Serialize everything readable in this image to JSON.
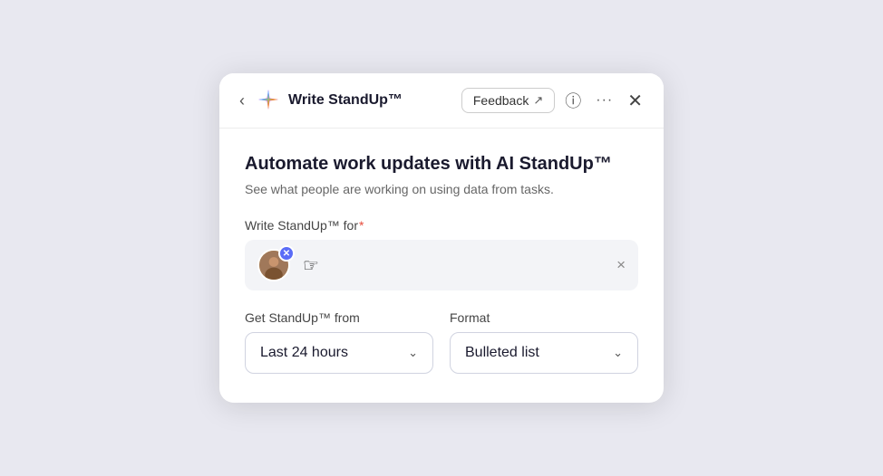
{
  "header": {
    "back_label": "‹",
    "title": "Write StandUp™",
    "feedback_label": "Feedback",
    "feedback_icon": "↗",
    "info_icon": "ⓘ",
    "more_icon": "•••",
    "close_icon": "×"
  },
  "main": {
    "title": "Automate work updates with AI StandUp™",
    "subtitle": "See what people are working on using data from tasks.",
    "for_label": "Write StandUp™ for",
    "required_marker": "*",
    "user_avatar_alt": "User avatar",
    "clear_label": "×",
    "from_label": "Get StandUp™ from",
    "from_value": "Last 24 hours",
    "format_label": "Format",
    "format_value": "Bulleted list"
  },
  "colors": {
    "accent": "#5a6cf7",
    "required": "#e74c3c",
    "border": "#d0d3e0"
  }
}
